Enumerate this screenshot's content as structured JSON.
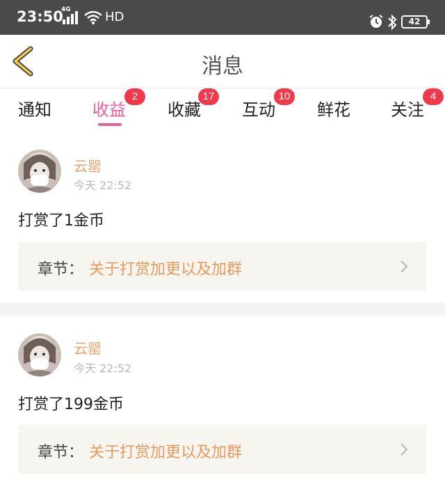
{
  "status_bar": {
    "time": "23:50",
    "network": "4G",
    "hd": "HD",
    "battery": "42"
  },
  "header": {
    "title": "消息"
  },
  "tabs": [
    {
      "label": "通知",
      "badge": ""
    },
    {
      "label": "收益",
      "badge": "2",
      "active": true
    },
    {
      "label": "收藏",
      "badge": "17"
    },
    {
      "label": "互动",
      "badge": "10"
    },
    {
      "label": "鲜花",
      "badge": ""
    },
    {
      "label": "关注",
      "badge": "4"
    }
  ],
  "messages": [
    {
      "username": "云罂",
      "time": "今天 22:52",
      "text": "打赏了1金币",
      "chapter_prefix": "章节：",
      "chapter_title": "关于打赏加更以及加群"
    },
    {
      "username": "云罂",
      "time": "今天 22:52",
      "text": "打赏了199金币",
      "chapter_prefix": "章节：",
      "chapter_title": "关于打赏加更以及加群"
    }
  ],
  "colors": {
    "accent": "#e85d9c",
    "badge": "#f0394b",
    "username": "#e8a06a",
    "chapter_link": "#e89a5c",
    "back_arrow": "#f2cc4e"
  },
  "icons": [
    "back-arrow-icon",
    "alarm-icon",
    "bluetooth-icon",
    "wifi-icon",
    "signal-icon",
    "battery-icon",
    "chevron-right-icon"
  ]
}
